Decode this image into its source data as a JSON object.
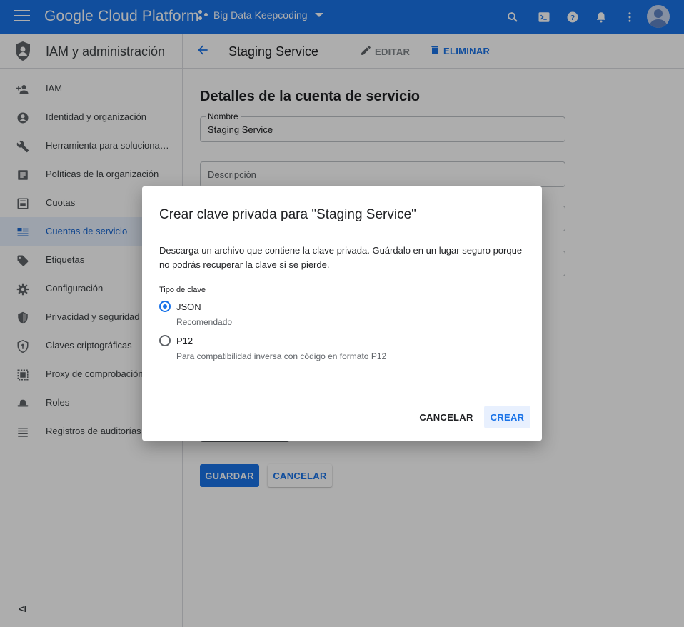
{
  "topbar": {
    "brand": "Google Cloud Platform",
    "project": "Big Data Keepcoding"
  },
  "subheader": {
    "section_title": "IAM y administración",
    "page_name": "Staging Service",
    "edit_label": "EDITAR",
    "delete_label": "ELIMINAR"
  },
  "sidebar": {
    "items": [
      {
        "label": "IAM",
        "icon": "person-add-icon"
      },
      {
        "label": "Identidad y organización",
        "icon": "account-circle-icon"
      },
      {
        "label": "Herramienta para solucionar…",
        "icon": "wrench-icon"
      },
      {
        "label": "Políticas de la organización",
        "icon": "document-icon"
      },
      {
        "label": "Cuotas",
        "icon": "quota-icon"
      },
      {
        "label": "Cuentas de servicio",
        "icon": "service-account-icon"
      },
      {
        "label": "Etiquetas",
        "icon": "tag-icon"
      },
      {
        "label": "Configuración",
        "icon": "gear-icon"
      },
      {
        "label": "Privacidad y seguridad",
        "icon": "shield-icon"
      },
      {
        "label": "Claves criptográficas",
        "icon": "crypto-shield-icon"
      },
      {
        "label": "Proxy de comprobación…",
        "icon": "proxy-icon"
      },
      {
        "label": "Roles",
        "icon": "hat-icon"
      },
      {
        "label": "Registros de auditorías",
        "icon": "list-icon"
      }
    ],
    "active_index": 5,
    "collapse_label": "<I"
  },
  "main": {
    "section_title": "Detalles de la cuenta de servicio",
    "name_label": "Nombre",
    "name_value": "Staging Service",
    "description_placeholder": "Descripción",
    "save_label": "GUARDAR",
    "cancel_label": "CANCELAR"
  },
  "dialog": {
    "title": "Crear clave privada para \"Staging Service\"",
    "description": "Descarga un archivo que contiene la clave privada. Guárdalo en un lugar seguro porque no podrás recuperar la clave si se pierde.",
    "key_type_label": "Tipo de clave",
    "options": [
      {
        "label": "JSON",
        "hint": "Recomendado",
        "checked": true
      },
      {
        "label": "P12",
        "hint": "Para compatibilidad inversa con código en formato P12",
        "checked": false
      }
    ],
    "cancel_label": "CANCELAR",
    "create_label": "CREAR"
  },
  "colors": {
    "accent": "#1a73e8",
    "topbar": "#1a73e8",
    "active_nav_bg": "#e8f0fe"
  }
}
